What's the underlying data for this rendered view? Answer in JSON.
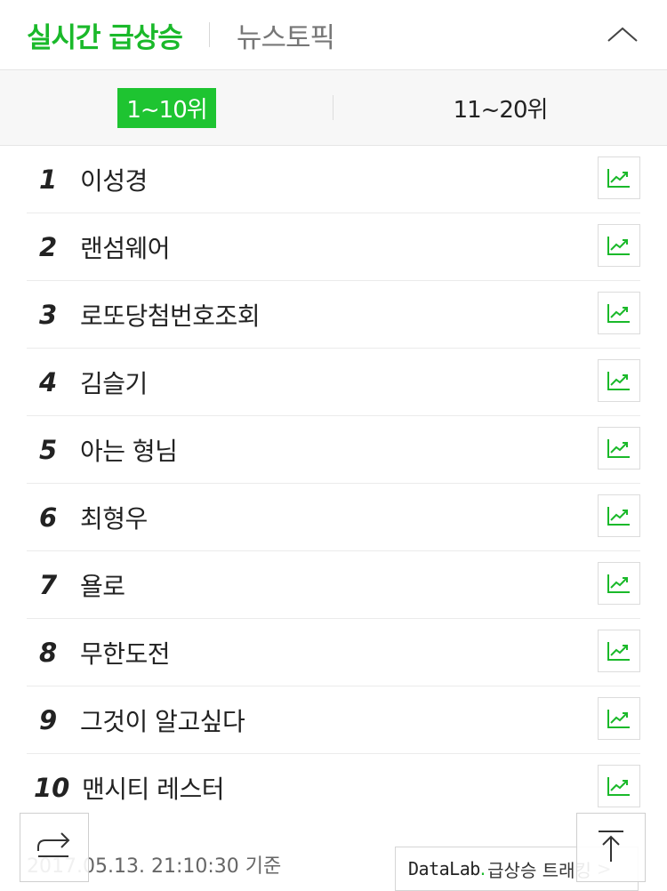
{
  "header": {
    "tab_main": "실시간 급상승",
    "tab_news": "뉴스토픽"
  },
  "rank_tabs": [
    {
      "label": "1~10위",
      "active": true
    },
    {
      "label": "11~20위",
      "active": false
    }
  ],
  "items": [
    {
      "rank": "1",
      "keyword": "이성경"
    },
    {
      "rank": "2",
      "keyword": "랜섬웨어"
    },
    {
      "rank": "3",
      "keyword": "로또당첨번호조회"
    },
    {
      "rank": "4",
      "keyword": "김슬기"
    },
    {
      "rank": "5",
      "keyword": "아는 형님"
    },
    {
      "rank": "6",
      "keyword": "최형우"
    },
    {
      "rank": "7",
      "keyword": "욜로"
    },
    {
      "rank": "8",
      "keyword": "무한도전"
    },
    {
      "rank": "9",
      "keyword": "그것이 알고싶다"
    },
    {
      "rank": "10",
      "keyword": "맨시티 레스터"
    }
  ],
  "footer": {
    "timestamp": "2017.05.13. 21:10:30 기준",
    "datalab_brand": "DataLab",
    "datalab_dot": ".",
    "datalab_text": "급상승 트래킹",
    "datalab_arrow": ">"
  },
  "icons": {
    "trend": "trend-chart-icon",
    "collapse": "chevron-up-icon",
    "share": "share-arrow-icon",
    "top": "scroll-top-icon"
  },
  "colors": {
    "accent": "#1ab92a",
    "active_tab_bg": "#1ec431"
  }
}
